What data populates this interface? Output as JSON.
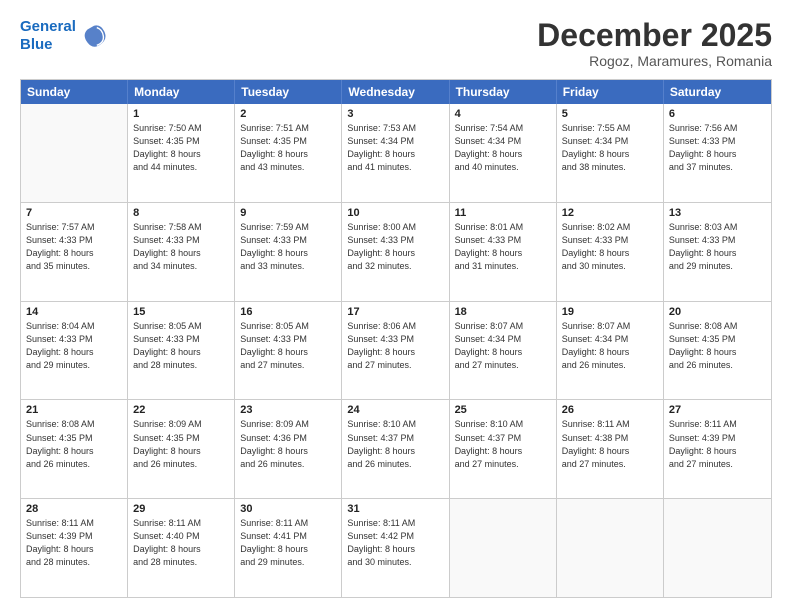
{
  "header": {
    "logo_line1": "General",
    "logo_line2": "Blue",
    "month": "December 2025",
    "location": "Rogoz, Maramures, Romania"
  },
  "weekdays": [
    "Sunday",
    "Monday",
    "Tuesday",
    "Wednesday",
    "Thursday",
    "Friday",
    "Saturday"
  ],
  "weeks": [
    [
      {
        "day": "",
        "info": ""
      },
      {
        "day": "1",
        "info": "Sunrise: 7:50 AM\nSunset: 4:35 PM\nDaylight: 8 hours\nand 44 minutes."
      },
      {
        "day": "2",
        "info": "Sunrise: 7:51 AM\nSunset: 4:35 PM\nDaylight: 8 hours\nand 43 minutes."
      },
      {
        "day": "3",
        "info": "Sunrise: 7:53 AM\nSunset: 4:34 PM\nDaylight: 8 hours\nand 41 minutes."
      },
      {
        "day": "4",
        "info": "Sunrise: 7:54 AM\nSunset: 4:34 PM\nDaylight: 8 hours\nand 40 minutes."
      },
      {
        "day": "5",
        "info": "Sunrise: 7:55 AM\nSunset: 4:34 PM\nDaylight: 8 hours\nand 38 minutes."
      },
      {
        "day": "6",
        "info": "Sunrise: 7:56 AM\nSunset: 4:33 PM\nDaylight: 8 hours\nand 37 minutes."
      }
    ],
    [
      {
        "day": "7",
        "info": "Sunrise: 7:57 AM\nSunset: 4:33 PM\nDaylight: 8 hours\nand 35 minutes."
      },
      {
        "day": "8",
        "info": "Sunrise: 7:58 AM\nSunset: 4:33 PM\nDaylight: 8 hours\nand 34 minutes."
      },
      {
        "day": "9",
        "info": "Sunrise: 7:59 AM\nSunset: 4:33 PM\nDaylight: 8 hours\nand 33 minutes."
      },
      {
        "day": "10",
        "info": "Sunrise: 8:00 AM\nSunset: 4:33 PM\nDaylight: 8 hours\nand 32 minutes."
      },
      {
        "day": "11",
        "info": "Sunrise: 8:01 AM\nSunset: 4:33 PM\nDaylight: 8 hours\nand 31 minutes."
      },
      {
        "day": "12",
        "info": "Sunrise: 8:02 AM\nSunset: 4:33 PM\nDaylight: 8 hours\nand 30 minutes."
      },
      {
        "day": "13",
        "info": "Sunrise: 8:03 AM\nSunset: 4:33 PM\nDaylight: 8 hours\nand 29 minutes."
      }
    ],
    [
      {
        "day": "14",
        "info": "Sunrise: 8:04 AM\nSunset: 4:33 PM\nDaylight: 8 hours\nand 29 minutes."
      },
      {
        "day": "15",
        "info": "Sunrise: 8:05 AM\nSunset: 4:33 PM\nDaylight: 8 hours\nand 28 minutes."
      },
      {
        "day": "16",
        "info": "Sunrise: 8:05 AM\nSunset: 4:33 PM\nDaylight: 8 hours\nand 27 minutes."
      },
      {
        "day": "17",
        "info": "Sunrise: 8:06 AM\nSunset: 4:33 PM\nDaylight: 8 hours\nand 27 minutes."
      },
      {
        "day": "18",
        "info": "Sunrise: 8:07 AM\nSunset: 4:34 PM\nDaylight: 8 hours\nand 27 minutes."
      },
      {
        "day": "19",
        "info": "Sunrise: 8:07 AM\nSunset: 4:34 PM\nDaylight: 8 hours\nand 26 minutes."
      },
      {
        "day": "20",
        "info": "Sunrise: 8:08 AM\nSunset: 4:35 PM\nDaylight: 8 hours\nand 26 minutes."
      }
    ],
    [
      {
        "day": "21",
        "info": "Sunrise: 8:08 AM\nSunset: 4:35 PM\nDaylight: 8 hours\nand 26 minutes."
      },
      {
        "day": "22",
        "info": "Sunrise: 8:09 AM\nSunset: 4:35 PM\nDaylight: 8 hours\nand 26 minutes."
      },
      {
        "day": "23",
        "info": "Sunrise: 8:09 AM\nSunset: 4:36 PM\nDaylight: 8 hours\nand 26 minutes."
      },
      {
        "day": "24",
        "info": "Sunrise: 8:10 AM\nSunset: 4:37 PM\nDaylight: 8 hours\nand 26 minutes."
      },
      {
        "day": "25",
        "info": "Sunrise: 8:10 AM\nSunset: 4:37 PM\nDaylight: 8 hours\nand 27 minutes."
      },
      {
        "day": "26",
        "info": "Sunrise: 8:11 AM\nSunset: 4:38 PM\nDaylight: 8 hours\nand 27 minutes."
      },
      {
        "day": "27",
        "info": "Sunrise: 8:11 AM\nSunset: 4:39 PM\nDaylight: 8 hours\nand 27 minutes."
      }
    ],
    [
      {
        "day": "28",
        "info": "Sunrise: 8:11 AM\nSunset: 4:39 PM\nDaylight: 8 hours\nand 28 minutes."
      },
      {
        "day": "29",
        "info": "Sunrise: 8:11 AM\nSunset: 4:40 PM\nDaylight: 8 hours\nand 28 minutes."
      },
      {
        "day": "30",
        "info": "Sunrise: 8:11 AM\nSunset: 4:41 PM\nDaylight: 8 hours\nand 29 minutes."
      },
      {
        "day": "31",
        "info": "Sunrise: 8:11 AM\nSunset: 4:42 PM\nDaylight: 8 hours\nand 30 minutes."
      },
      {
        "day": "",
        "info": ""
      },
      {
        "day": "",
        "info": ""
      },
      {
        "day": "",
        "info": ""
      }
    ]
  ]
}
